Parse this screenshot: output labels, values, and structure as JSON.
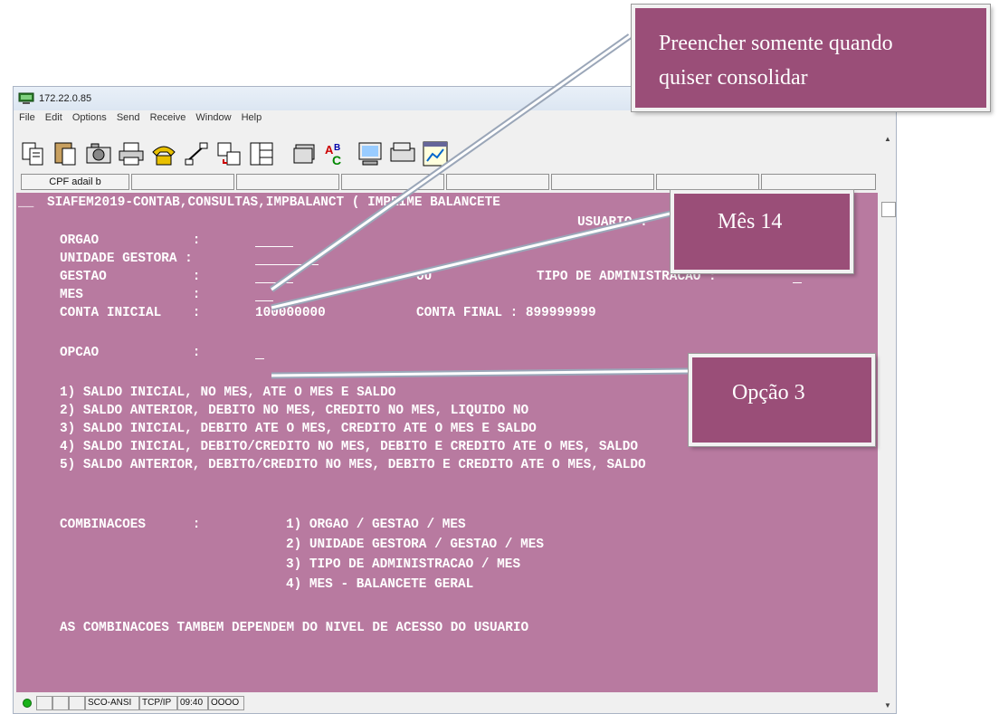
{
  "window": {
    "title": "172.22.0.85",
    "menu": [
      "File",
      "Edit",
      "Options",
      "Send",
      "Receive",
      "Window",
      "Help"
    ],
    "key_label": "CPF adail b"
  },
  "screen": {
    "header": "SIAFEM2019-CONTAB,CONSULTAS,IMPBALANCT ( IMPRIME BALANCETE",
    "usuario": "USUARIO :",
    "fields": {
      "orgao": "ORGAO            :",
      "unidade_gestora": "UNIDADE GESTORA :",
      "gestao": "GESTAO           :",
      "ou": "OU",
      "tipo_adm": "TIPO DE ADMINISTRACAO :",
      "mes": "MES              :",
      "conta_inicial_label": "CONTA INICIAL    :",
      "conta_inicial_value": "100000000",
      "conta_final": "CONTA FINAL : 899999999",
      "opcao": "OPCAO            :"
    },
    "options": [
      "1) SALDO INICIAL, NO MES, ATE O MES E SALDO",
      "2) SALDO ANTERIOR, DEBITO NO MES, CREDITO NO MES, LIQUIDO NO",
      "3) SALDO INICIAL, DEBITO ATE O MES, CREDITO ATE O MES E SALDO",
      "4) SALDO INICIAL, DEBITO/CREDITO NO MES, DEBITO E CREDITO ATE O MES, SALDO",
      "5) SALDO ANTERIOR, DEBITO/CREDITO NO MES, DEBITO E CREDITO ATE O MES, SALDO"
    ],
    "combinacoes_label": "COMBINACOES      :",
    "combinacoes": [
      "1) ORGAO / GESTAO / MES",
      "2) UNIDADE GESTORA / GESTAO / MES",
      "3) TIPO DE ADMINISTRACAO / MES",
      "4) MES - BALANCETE GERAL"
    ],
    "footer": "AS COMBINACOES TAMBEM DEPENDEM DO NIVEL DE ACESSO DO USUARIO"
  },
  "statusbar": {
    "emulation": "SCO-ANSI",
    "protocol": "TCP/IP",
    "time": "09:40",
    "indicator": "OOOO"
  },
  "callouts": {
    "consolidar": [
      "Preencher somente quando",
      "quiser consolidar"
    ],
    "mes14": "Mês 14",
    "opcao3": "Opção 3"
  },
  "colors": {
    "screen_bg": "#b87aa0",
    "callout_bg": "#9a4e78"
  }
}
